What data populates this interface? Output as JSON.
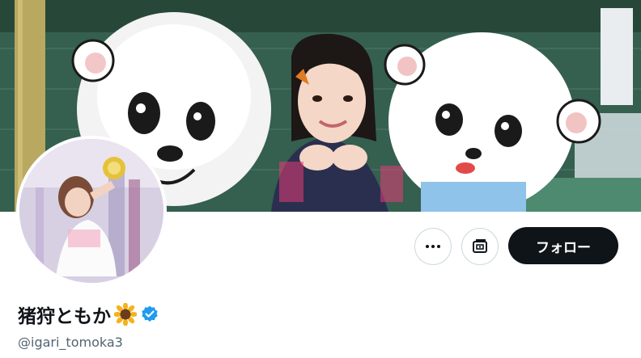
{
  "profile": {
    "display_name": "猪狩ともか",
    "handle": "@igari_tomoka3",
    "verified": true,
    "name_emoji": "sunflower-icon"
  },
  "actions": {
    "more_icon": "more-dots-icon",
    "subscribe_icon": "subscribe-notification-icon",
    "follow_label": "フォロー"
  },
  "colors": {
    "follow_bg": "#0f1419",
    "verified_blue": "#1d9bf0",
    "handle_gray": "#536471"
  }
}
